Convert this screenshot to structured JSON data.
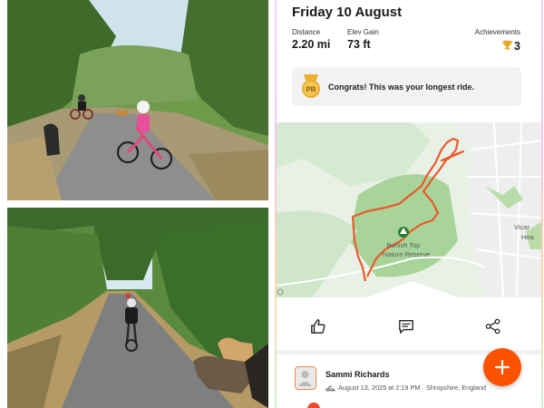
{
  "activity": {
    "date_title": "Friday 10 August",
    "stats": [
      {
        "label": "Distance",
        "value": "2.20 mi"
      },
      {
        "label": "Elev Gain",
        "value": "73 ft"
      }
    ],
    "achievements": {
      "label": "Achievements",
      "count": "3",
      "icon": "trophy-icon"
    }
  },
  "pr_banner": {
    "badge": "PR",
    "message": "Congrats! This was your longest ride."
  },
  "map": {
    "place_label_line1": "Burlish Top",
    "place_label_line2": "Nature Reserve",
    "edge_label_1": "Vicar",
    "edge_label_2": "Hea",
    "attribution_icon": "info-icon",
    "reserve_icon": "tree-icon",
    "route_color": "#ea5a2a"
  },
  "actions": [
    {
      "name": "like",
      "icon": "thumbs-up-icon"
    },
    {
      "name": "comment",
      "icon": "comment-icon"
    },
    {
      "name": "share",
      "icon": "share-icon"
    }
  ],
  "comment": {
    "author": "Sammi Richards",
    "meta": "August 13, 2025 at 2:19 PM · Shropshire, England",
    "meta_icon": "bike-icon"
  },
  "fab": {
    "icon": "plus-icon",
    "color": "#fc5200"
  }
}
